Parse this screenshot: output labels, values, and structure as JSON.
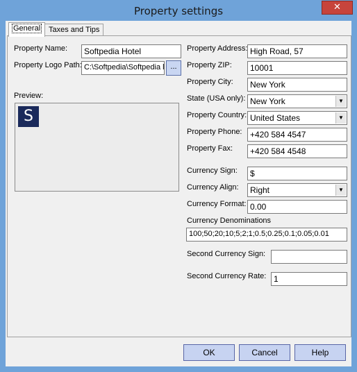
{
  "window": {
    "title": "Property settings",
    "close_glyph": "✕"
  },
  "tabs": [
    {
      "label": "General"
    },
    {
      "label": "Taxes and Tips"
    }
  ],
  "general": {
    "property_name_label": "Property Name:",
    "property_name_value": "Softpedia Hotel",
    "logo_path_label": "Property Logo Path:",
    "logo_path_value": "C:\\Softpedia\\Softpedia l",
    "browse_label": "...",
    "preview_label": "Preview:",
    "logo_letter": "S",
    "address_label": "Property Address:",
    "address_value": "High Road, 57",
    "zip_label": "Property ZIP:",
    "zip_value": "10001",
    "city_label": "Property City:",
    "city_value": "New York",
    "state_label": "State (USA only):",
    "state_value": "New York",
    "country_label": "Property Country:",
    "country_value": "United States",
    "phone_label": "Property Phone:",
    "phone_value": "+420 584 4547",
    "fax_label": "Property Fax:",
    "fax_value": "+420 584 4548",
    "currency_sign_label": "Currency Sign:",
    "currency_sign_value": "$",
    "currency_align_label": "Currency Align:",
    "currency_align_value": "Right",
    "currency_format_label": "Currency Format:",
    "currency_format_value": "0.00",
    "denominations_label": "Currency Denominations",
    "denominations_value": "100;50;20;10;5;2;1;0.5;0.25;0.1;0.05;0.01",
    "second_sign_label": "Second Currency Sign:",
    "second_sign_value": "",
    "second_rate_label": "Second Currency Rate:",
    "second_rate_value": "1"
  },
  "footer": {
    "ok_label": "OK",
    "cancel_label": "Cancel",
    "help_label": "Help"
  }
}
